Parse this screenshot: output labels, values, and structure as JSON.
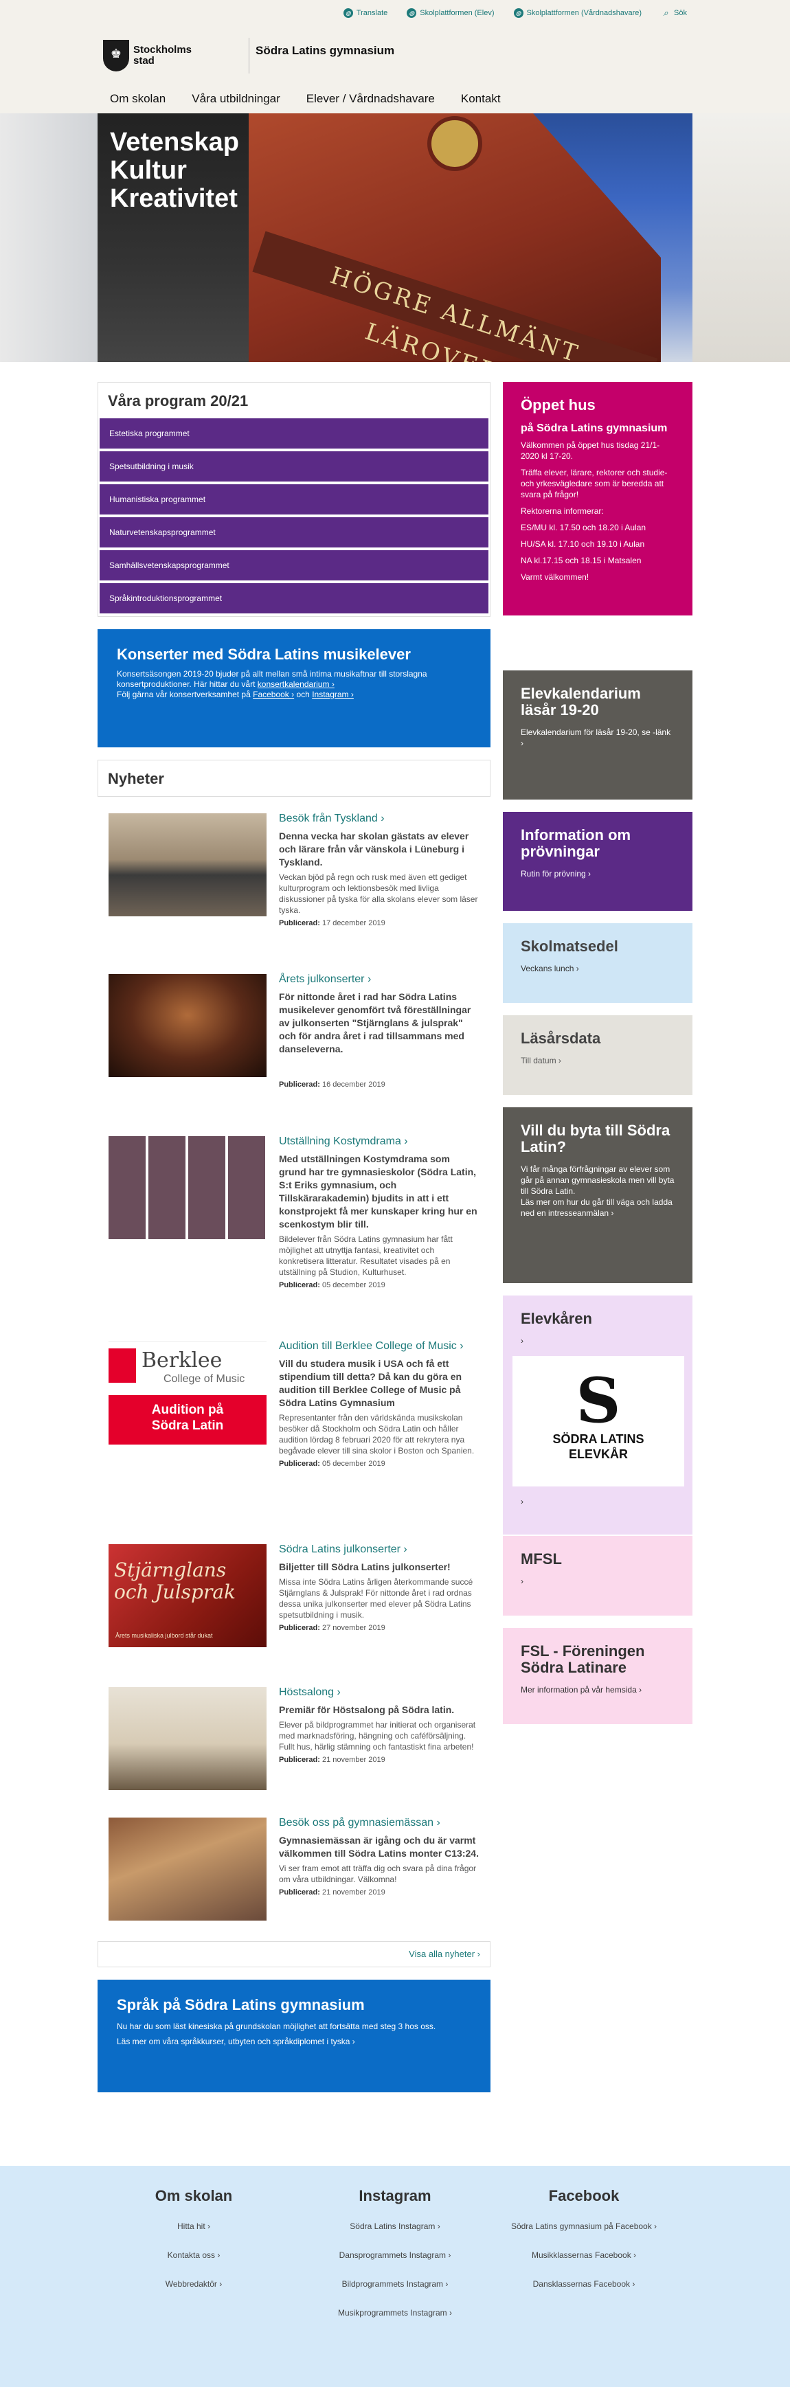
{
  "header": {
    "utility": {
      "translate": "Translate",
      "skolplattformen_elev": "Skolplattformen (Elev)",
      "skolplattformen_vardnad": "Skolplattformen (Vårdnadshavare)",
      "search": "Sök"
    },
    "logo_text": "Stockholms\nstad",
    "site_title": "Södra Latins gymnasium",
    "nav": [
      "Om skolan",
      "Våra utbildningar",
      "Elever / Vårdnadshavare",
      "Kontakt"
    ]
  },
  "hero": {
    "title": "Vetenskap\nKultur\nKreativitet",
    "building_text": "HÖGRE ALLMÄNT LÄROVERK"
  },
  "programs": {
    "title": "Våra program 20/21",
    "items": [
      "Estetiska programmet",
      "Spetsutbildning i musik",
      "Humanistiska programmet",
      "Naturvetenskapsprogrammet",
      "Samhällsvetenskapsprogrammet",
      "Språkintroduktionsprogrammet"
    ]
  },
  "konsert": {
    "title": "Konserter med Södra Latins musikelever",
    "text": "Konsertsäsongen 2019-20 bjuder på allt mellan små intima musikaftnar till storslagna konsertproduktioner. Här hittar du vårt",
    "link1": "konsertkalendarium ›",
    "text2": "Följ gärna vår konsertverksamhet på",
    "link2": "Facebook ›",
    "and": "och",
    "link3": "Instagram ›"
  },
  "nyheter": {
    "title": "Nyheter",
    "pub_label": "Publicerad:",
    "items": [
      {
        "title": "Besök från Tyskland ›",
        "lead": "Denna vecka har skolan gästats av elever och lärare från vår vänskola i Lüneburg i Tyskland.",
        "body": "Veckan bjöd på regn och rusk med även ett gediget kulturprogram och lektionsbesök med livliga diskussioner på tyska för alla skolans elever som läser tyska.",
        "date": "17 december 2019"
      },
      {
        "title": "Årets julkonserter ›",
        "lead": "För nittonde året i rad har Södra Latins musikelever genomfört två föreställningar av julkonserten \"Stjärnglans & julsprak\" och för andra året i rad tillsammans med danseleverna.",
        "body": "",
        "date": "16 december 2019"
      },
      {
        "title": "Utställning Kostymdrama ›",
        "lead": "Med utställningen Kostymdrama som grund har tre gymnasieskolor (Södra Latin, S:t Eriks gymnasium, och Tillskärarakademin) bjudits in att i ett konstprojekt få mer kunskaper kring hur en scenkostym blir till.",
        "body": "Bildelever från Södra Latins gymnasium har fått möjlighet att utnyttja fantasi, kreativitet och konkretisera litteratur. Resultatet visades på en utställning på Studion, Kulturhuset.",
        "date": "05 december 2019"
      },
      {
        "title": "Audition till Berklee College of Music ›",
        "lead": "Vill du studera musik i USA och få ett stipendium till detta? Då kan du göra en audition till Berklee College of Music på Södra Latins Gymnasium",
        "body": "Representanter från den världskända musikskolan besöker då Stockholm och Södra Latin och håller audition lördag 8 februari 2020 för att rekrytera nya begåvade elever till sina skolor i Boston och Spanien.",
        "date": "05 december 2019"
      },
      {
        "title": "Södra Latins julkonserter ›",
        "lead": "Biljetter till Södra Latins julkonserter!",
        "body": "Missa inte Södra Latins årligen återkommande succé Stjärnglans & Julsprak! För nittonde året i rad ordnas dessa unika julkonserter med elever på Södra Latins spetsutbildning i musik.",
        "date": "27 november 2019"
      },
      {
        "title": "Höstsalong ›",
        "lead": "Premiär för Höstsalong på Södra latin.",
        "body": "Elever på bildprogrammet har initierat och organiserat med marknadsföring, hängning och caféförsäljning. Fullt hus, härlig stämning och fantastiskt fina arbeten!",
        "date": "21 november 2019"
      },
      {
        "title": "Besök oss på gymnasiemässan ›",
        "lead": "Gymnasiemässan är igång och du är varmt välkommen till Södra Latins monter C13:24.",
        "body": "Vi ser fram emot att träffa dig och svara på dina frågor om våra utbildningar. Välkomna!",
        "date": "21 november 2019"
      }
    ],
    "berklee": {
      "name": "Berklee",
      "sub": "College of Music",
      "cta": "Audition på\nSödra Latin"
    },
    "julkonsert_img_text": "Stjärnglans\noch Julsprak",
    "julkonsert_img_sub": "Årets musikaliska julbord står dukat",
    "visa_alla": "Visa alla nyheter ›"
  },
  "sprak": {
    "title": "Språk på Södra Latins gymnasium",
    "text": "Nu har du som läst kinesiska på grundskolan möjlighet att fortsätta med steg 3 hos oss.",
    "text2": "Läs mer om våra språkkurser, utbyten och språkdiplomet i tyska ›"
  },
  "sidebar": {
    "oppet": {
      "title": "Öppet hus",
      "subtitle": "på Södra Latins gymnasium",
      "p1": "Välkommen på öppet hus tisdag 21/1-2020 kl 17-20.",
      "p2": "Träffa elever, lärare, rektorer och studie-och yrkesvägledare som är beredda att svara på frågor!",
      "p3": "Rektorerna informerar:",
      "p4": "ES/MU kl. 17.50 och 18.20 i Aulan",
      "p5": "HU/SA kl. 17.10 och 19.10 i Aulan",
      "p6": "NA kl.17.15 och 18.15 i Matsalen",
      "p7": "Varmt välkommen!"
    },
    "elevkal": {
      "title": "Elevkalendarium läsår 19-20",
      "text": "Elevkalendarium för läsår 19-20, se -länk ›"
    },
    "prov": {
      "title": "Information om prövningar",
      "text": "Rutin för prövning ›"
    },
    "skol": {
      "title": "Skolmatsedel",
      "text": "Veckans lunch ›"
    },
    "lasar": {
      "title": "Läsårsdata",
      "text": "Till datum ›"
    },
    "vill": {
      "title": "Vill du byta till Södra Latin?",
      "p1": "Vi får många förfrågningar av elever som går på annan gymnasieskola men vill byta till Södra Latin.",
      "p2": "Läs mer om hur du går till väga och ladda ned en intresseanmälan ›"
    },
    "elevk": {
      "title": "Elevkåren",
      "arrow": "›",
      "logo_letter": "S",
      "logo_text": "SÖDRA LATINS\nELEVKÅR"
    },
    "mfsl": {
      "title": "MFSL",
      "arrow": "›"
    },
    "fsl": {
      "title": "FSL - Föreningen Södra Latinare",
      "text": "Mer information på vår hemsida ›"
    }
  },
  "footer": {
    "cols": [
      {
        "title": "Om skolan",
        "links": [
          "Hitta hit ›",
          "Kontakta oss ›",
          "Webbredaktör ›"
        ]
      },
      {
        "title": "Instagram",
        "links": [
          "Södra Latins Instagram ›",
          "Dansprogrammets Instagram ›",
          "Bildprogrammets Instagram ›",
          "Musikprogrammets Instagram ›"
        ]
      },
      {
        "title": "Facebook",
        "links": [
          "Södra Latins gymnasium på Facebook ›",
          "Musikklassernas Facebook ›",
          "Dansklassernas Facebook ›"
        ]
      }
    ]
  }
}
